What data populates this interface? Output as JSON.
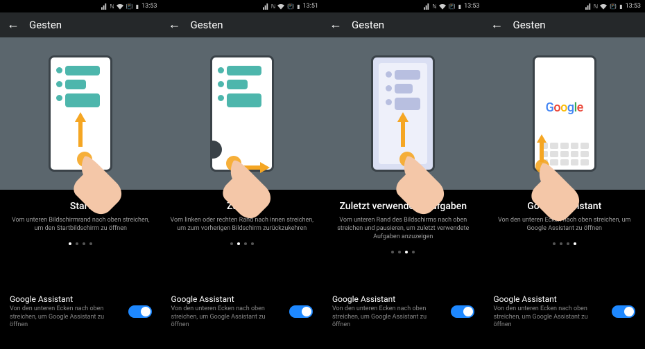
{
  "status_time": "13:53",
  "status_time_alt": "13:51",
  "header_title": "Gesten",
  "screens": [
    {
      "time": "13:53",
      "gesture_title": "Start",
      "gesture_desc": "Vom unteren Bildschirmrand nach oben streichen, um den Startbildschirm zu öffnen",
      "active_dot": 0
    },
    {
      "time": "13:51",
      "gesture_title": "Zurück",
      "gesture_desc": "Vom linken oder rechten Rand nach innen streichen, um zum vorherigen Bildschirm zurückzukehren",
      "active_dot": 1
    },
    {
      "time": "13:53",
      "gesture_title": "Zuletzt verwendete Aufgaben",
      "gesture_desc": "Vom unteren Rand des Bildschirms nach oben streichen und pausieren, um zuletzt verwendete Aufgaben anzuzeigen",
      "active_dot": 2
    },
    {
      "time": "13:53",
      "gesture_title": "Google Assistant",
      "gesture_desc": "Von den unteren Ecken nach oben streichen, um Google Assistant zu öffnen",
      "active_dot": 3
    }
  ],
  "setting": {
    "title": "Google Assistant",
    "desc": "Von den unteren Ecken nach oben streichen, um Google Assistant zu öffnen",
    "enabled": true
  },
  "google_letters": [
    "G",
    "o",
    "o",
    "g",
    "l",
    "e"
  ]
}
